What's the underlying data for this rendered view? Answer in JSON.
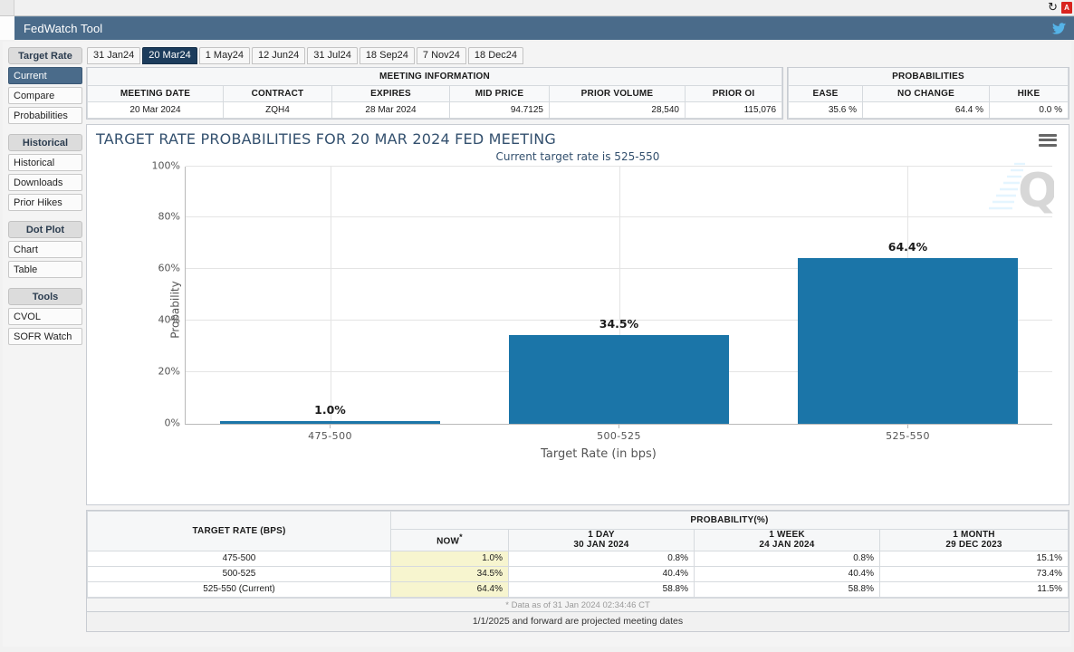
{
  "browser": {
    "refresh_icon": "refresh-icon",
    "pdf_icon": "pdf-icon",
    "pdf_label": "A"
  },
  "header": {
    "title": "FedWatch Tool",
    "social_icon": "twitter-icon"
  },
  "sidebar": {
    "groups": [
      {
        "heading": "Target Rate",
        "items": [
          {
            "label": "Current",
            "active": true
          },
          {
            "label": "Compare",
            "active": false
          },
          {
            "label": "Probabilities",
            "active": false
          }
        ]
      },
      {
        "heading": "Historical",
        "items": [
          {
            "label": "Historical",
            "active": false
          },
          {
            "label": "Downloads",
            "active": false
          },
          {
            "label": "Prior Hikes",
            "active": false
          }
        ]
      },
      {
        "heading": "Dot Plot",
        "items": [
          {
            "label": "Chart",
            "active": false
          },
          {
            "label": "Table",
            "active": false
          }
        ]
      },
      {
        "heading": "Tools",
        "items": [
          {
            "label": "CVOL",
            "active": false
          },
          {
            "label": "SOFR Watch",
            "active": false
          }
        ]
      }
    ]
  },
  "tabs": [
    {
      "label": "31 Jan24",
      "active": false
    },
    {
      "label": "20 Mar24",
      "active": true
    },
    {
      "label": "1 May24",
      "active": false
    },
    {
      "label": "12 Jun24",
      "active": false
    },
    {
      "label": "31 Jul24",
      "active": false
    },
    {
      "label": "18 Sep24",
      "active": false
    },
    {
      "label": "7 Nov24",
      "active": false
    },
    {
      "label": "18 Dec24",
      "active": false
    }
  ],
  "meeting_information": {
    "group_title": "MEETING INFORMATION",
    "columns": [
      "MEETING DATE",
      "CONTRACT",
      "EXPIRES",
      "MID PRICE",
      "PRIOR VOLUME",
      "PRIOR OI"
    ],
    "row": {
      "meeting_date": "20 Mar 2024",
      "contract": "ZQH4",
      "expires": "28 Mar 2024",
      "mid_price": "94.7125",
      "prior_volume": "28,540",
      "prior_oi": "115,076"
    }
  },
  "probabilities_summary": {
    "group_title": "PROBABILITIES",
    "columns": [
      "EASE",
      "NO CHANGE",
      "HIKE"
    ],
    "row": {
      "ease": "35.6 %",
      "no_change": "64.4 %",
      "hike": "0.0 %"
    }
  },
  "chart_data": {
    "type": "bar",
    "title": "TARGET RATE PROBABILITIES FOR 20 MAR 2024 FED MEETING",
    "subtitle": "Current target rate is 525-550",
    "categories": [
      "475-500",
      "500-525",
      "525-550"
    ],
    "values": [
      1.0,
      34.5,
      64.4
    ],
    "value_labels": [
      "1.0%",
      "34.5%",
      "64.4%"
    ],
    "xlabel": "Target Rate (in bps)",
    "ylabel": "Probability",
    "ylim": [
      0,
      100
    ],
    "yticks": [
      0,
      20,
      40,
      60,
      80,
      100
    ],
    "ytick_labels": [
      "0%",
      "20%",
      "40%",
      "60%",
      "80%",
      "100%"
    ],
    "grid": true,
    "legend": "none",
    "bar_color": "#1b75a8",
    "menu_icon": "hamburger-menu-icon",
    "watermark": "Q"
  },
  "probability_table": {
    "row_header": "TARGET RATE (BPS)",
    "group_header": "PROBABILITY(%)",
    "columns": [
      {
        "line1": "NOW",
        "line2": "",
        "star": true
      },
      {
        "line1": "1 DAY",
        "line2": "30 JAN 2024",
        "star": false
      },
      {
        "line1": "1 WEEK",
        "line2": "24 JAN 2024",
        "star": false
      },
      {
        "line1": "1 MONTH",
        "line2": "29 DEC 2023",
        "star": false
      }
    ],
    "rows": [
      {
        "rate": "475-500",
        "now": "1.0%",
        "one_day": "0.8%",
        "one_week": "0.8%",
        "one_month": "15.1%"
      },
      {
        "rate": "500-525",
        "now": "34.5%",
        "one_day": "40.4%",
        "one_week": "40.4%",
        "one_month": "73.4%"
      },
      {
        "rate": "525-550 (Current)",
        "now": "64.4%",
        "one_day": "58.8%",
        "one_week": "58.8%",
        "one_month": "11.5%"
      }
    ],
    "note": "* Data as of 31 Jan 2024 02:34:46 CT"
  },
  "footer": {
    "text": "1/1/2025 and forward are projected meeting dates"
  }
}
